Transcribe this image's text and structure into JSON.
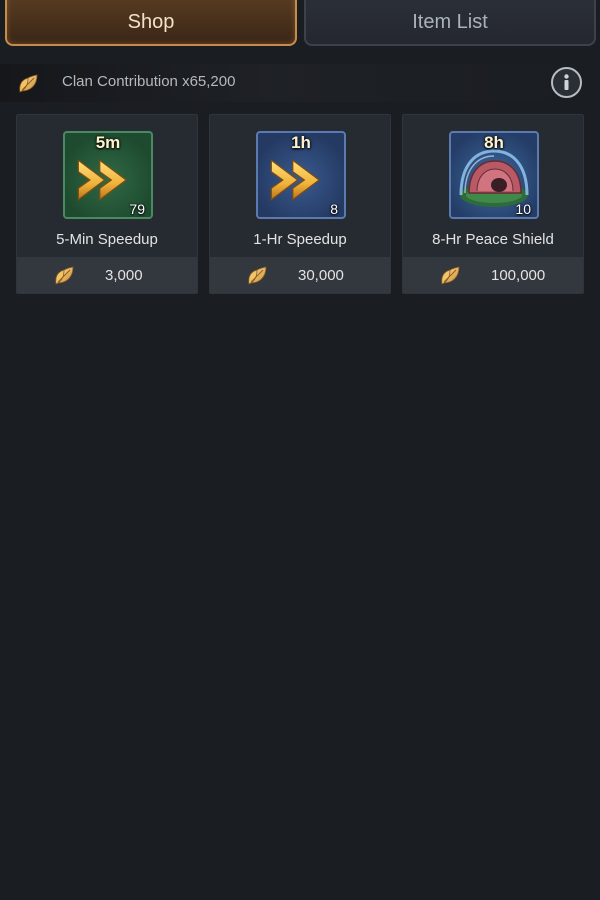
{
  "tabs": [
    {
      "label": "Shop",
      "active": true
    },
    {
      "label": "Item List",
      "active": false
    }
  ],
  "banner": {
    "text": "Clan Contribution x65,200",
    "currency_icon": "leaf-icon",
    "info_icon": "info-icon"
  },
  "items": [
    {
      "name": "5-Min Speedup",
      "duration": "5m",
      "quantity": "79",
      "price": "3,000",
      "icon": "speedup-icon"
    },
    {
      "name": "1-Hr Speedup",
      "duration": "1h",
      "quantity": "8",
      "price": "30,000",
      "icon": "speedup-icon"
    },
    {
      "name": "8-Hr Peace Shield",
      "duration": "8h",
      "quantity": "10",
      "price": "100,000",
      "icon": "peace-shield-icon"
    }
  ],
  "colors": {
    "background": "#1a1d22",
    "active_tab_border": "#c78b4a",
    "card": "#262a31",
    "price_bar": "#33373e",
    "leaf_gold": "#e0a84a"
  }
}
